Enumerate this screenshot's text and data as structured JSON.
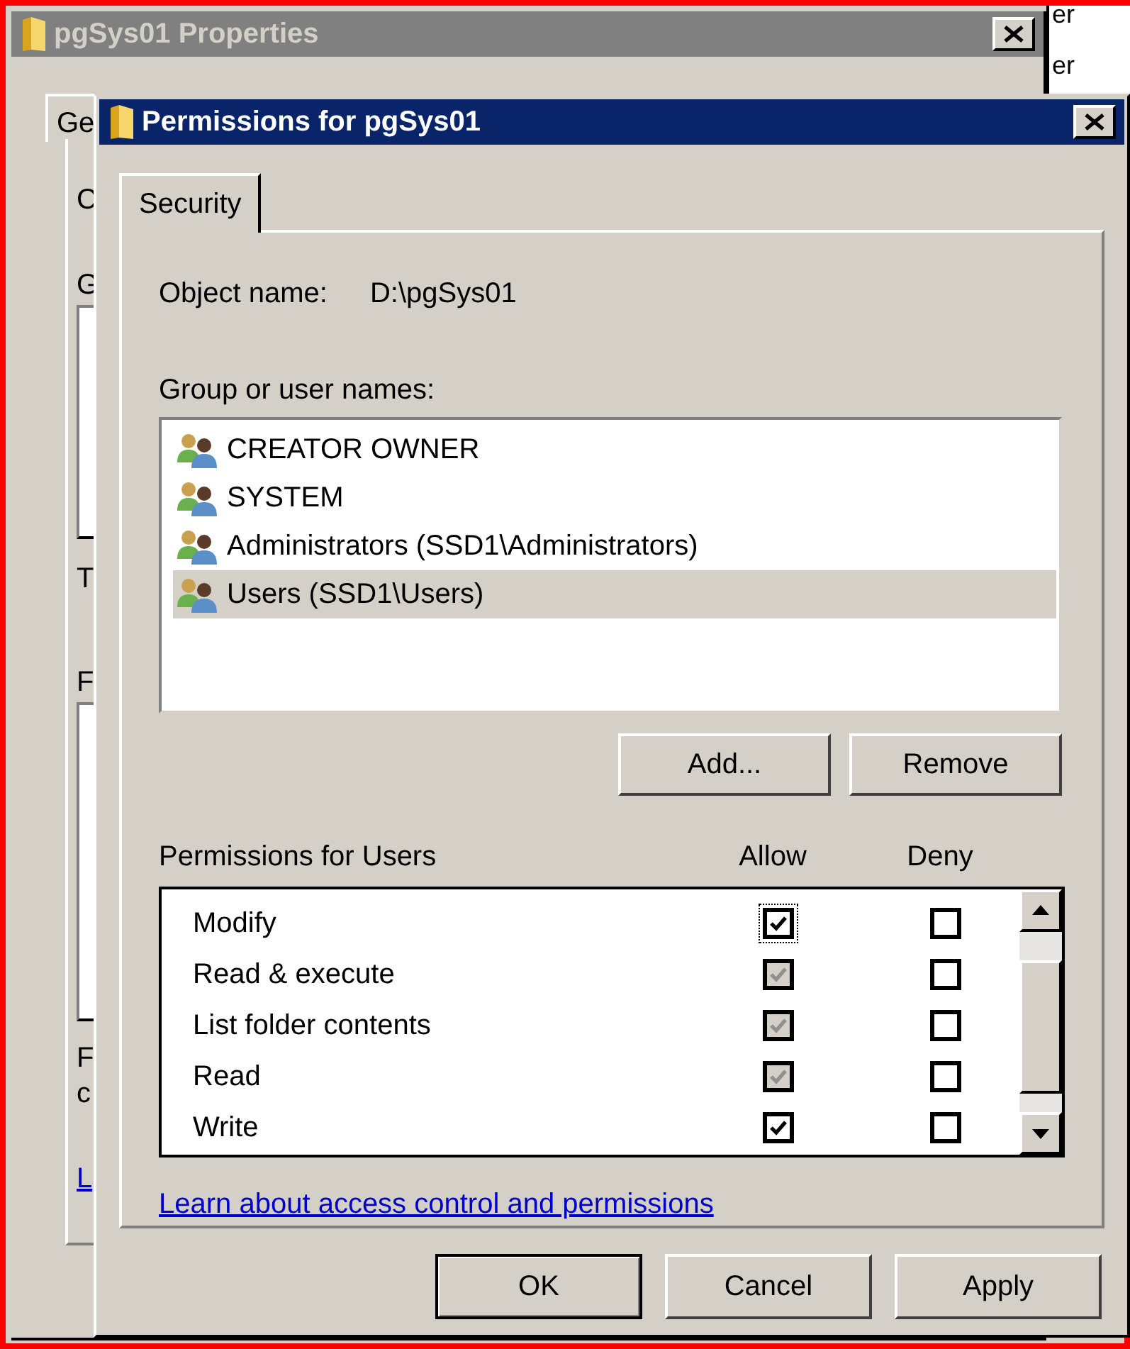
{
  "background_window": {
    "title": "pgSys01 Properties",
    "tab": "Ge",
    "fragments": [
      "C",
      "G",
      "T",
      "F",
      "F",
      "c"
    ],
    "link": "L",
    "side_texts": [
      "er",
      "er"
    ]
  },
  "dialog": {
    "title": "Permissions for pgSys01",
    "tabs": [
      {
        "label": "Security",
        "selected": true
      }
    ],
    "object_name_label": "Object name:",
    "object_name": "D:\\pgSys01",
    "group_label": "Group or user names:",
    "principals": [
      {
        "name": "CREATOR OWNER",
        "selected": false
      },
      {
        "name": "SYSTEM",
        "selected": false
      },
      {
        "name": "Administrators (SSD1\\Administrators)",
        "selected": false
      },
      {
        "name": "Users (SSD1\\Users)",
        "selected": true
      }
    ],
    "list_buttons": [
      "Add...",
      "Remove"
    ],
    "permissions_label": "Permissions for Users",
    "columns": [
      "Allow",
      "Deny"
    ],
    "permissions": [
      {
        "name": "Modify",
        "allow": true,
        "allow_disabled": false,
        "deny": false,
        "focused": true
      },
      {
        "name": "Read & execute",
        "allow": true,
        "allow_disabled": true,
        "deny": false,
        "focused": false
      },
      {
        "name": "List folder contents",
        "allow": true,
        "allow_disabled": true,
        "deny": false,
        "focused": false
      },
      {
        "name": "Read",
        "allow": true,
        "allow_disabled": true,
        "deny": false,
        "focused": false
      },
      {
        "name": "Write",
        "allow": true,
        "allow_disabled": false,
        "deny": false,
        "focused": false
      }
    ],
    "link": "Learn about access control and permissions",
    "buttons": [
      {
        "label": "OK",
        "default": true
      },
      {
        "label": "Cancel",
        "default": false
      },
      {
        "label": "Apply",
        "default": false
      }
    ]
  }
}
